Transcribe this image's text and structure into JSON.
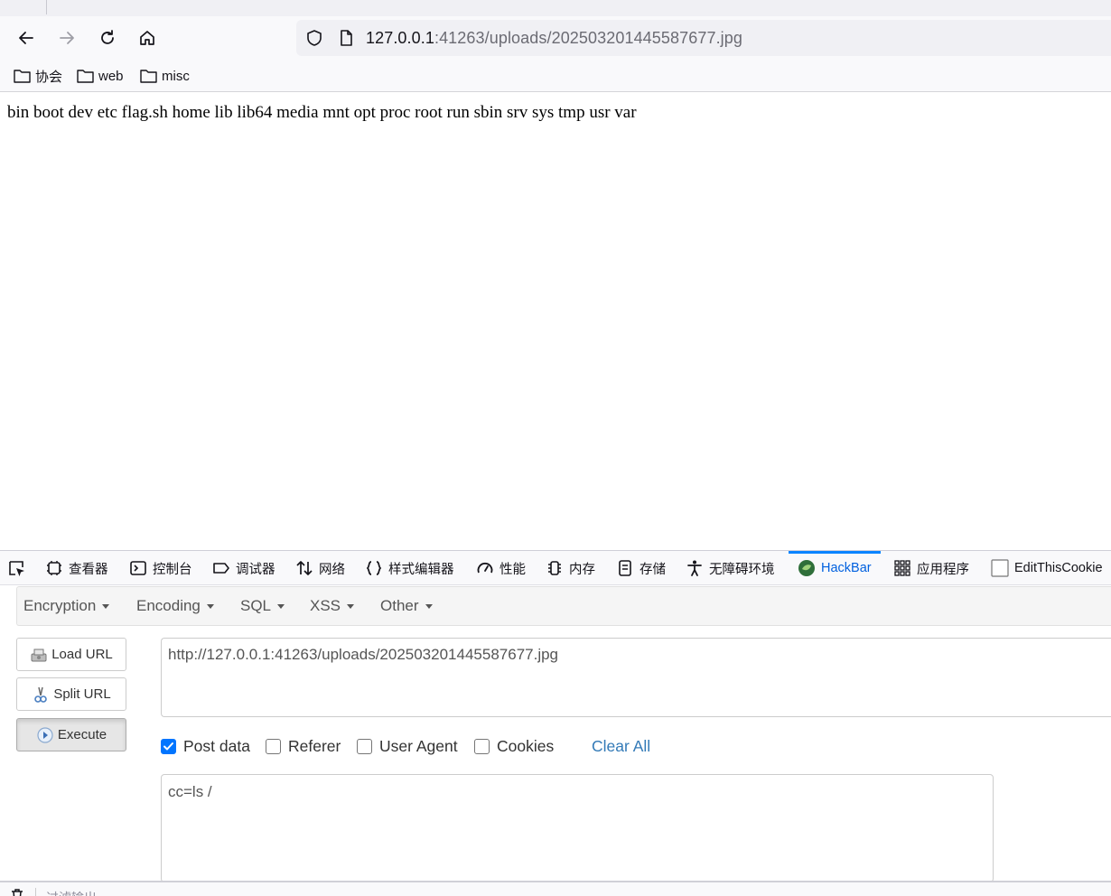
{
  "browser": {
    "url_host": "127.0.0.1",
    "url_rest": ":41263/uploads/202503201445587677.jpg",
    "bookmarks": [
      {
        "label": "协会",
        "icon": "folder-icon"
      },
      {
        "label": "web",
        "icon": "folder-icon"
      },
      {
        "label": "misc",
        "icon": "folder-icon"
      }
    ]
  },
  "page": {
    "output": "bin boot dev etc flag.sh home lib lib64 media mnt opt proc root run sbin srv sys tmp usr var"
  },
  "devtools": {
    "tabs": [
      {
        "label": "查看器",
        "icon": "inspector-icon"
      },
      {
        "label": "控制台",
        "icon": "console-icon"
      },
      {
        "label": "调试器",
        "icon": "debugger-icon"
      },
      {
        "label": "网络",
        "icon": "network-icon"
      },
      {
        "label": "样式编辑器",
        "icon": "style-editor-icon"
      },
      {
        "label": "性能",
        "icon": "performance-icon"
      },
      {
        "label": "内存",
        "icon": "memory-icon"
      },
      {
        "label": "存储",
        "icon": "storage-icon"
      },
      {
        "label": "无障碍环境",
        "icon": "accessibility-icon"
      },
      {
        "label": "HackBar",
        "icon": "hackbar-icon",
        "active": true
      },
      {
        "label": "应用程序",
        "icon": "application-icon"
      },
      {
        "label": "EditThisCookie",
        "icon": "cookie-icon"
      }
    ],
    "console_filter_placeholder": "过滤输出"
  },
  "hackbar": {
    "menus": [
      "Encryption",
      "Encoding",
      "SQL",
      "XSS",
      "Other"
    ],
    "load_url": "Load URL",
    "split_url": "Split URL",
    "execute": "Execute",
    "url_value": "http://127.0.0.1:41263/uploads/202503201445587677.jpg",
    "options": [
      {
        "label": "Post data",
        "checked": true
      },
      {
        "label": "Referer",
        "checked": false
      },
      {
        "label": "User Agent",
        "checked": false
      },
      {
        "label": "Cookies",
        "checked": false
      }
    ],
    "clear_all": "Clear All",
    "post_data_value": "cc=ls /"
  },
  "colors": {
    "accent": "#0a84ff",
    "link": "#337ab7",
    "checkbox": "#0075ff"
  }
}
